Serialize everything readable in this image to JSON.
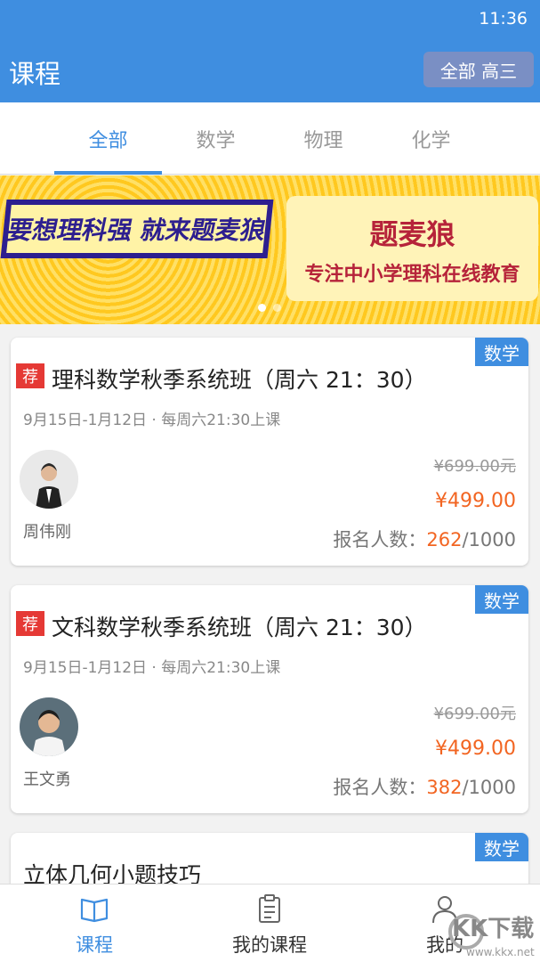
{
  "status": {
    "time": "11:36"
  },
  "header": {
    "title": "课程",
    "filter": "全部 高三"
  },
  "tabs": [
    {
      "label": "全部",
      "active": true
    },
    {
      "label": "数学",
      "active": false
    },
    {
      "label": "物理",
      "active": false
    },
    {
      "label": "化学",
      "active": false
    }
  ],
  "banner": {
    "slogan": "要想理科强 就来题麦狼",
    "brand": "题麦狼",
    "tagline": "专注中小学理科在线教育",
    "dots": 2,
    "active_dot": 0
  },
  "courses": [
    {
      "subject": "数学",
      "recommended": "荐",
      "title": "理科数学秋季系统班（周六 21：30）",
      "schedule": "9月15日-1月12日 · 每周六21:30上课",
      "teacher": "周伟刚",
      "original_price": "¥699.00元",
      "price": "¥499.00",
      "enroll_label": "报名人数：",
      "enrolled": "262",
      "capacity": "/1000"
    },
    {
      "subject": "数学",
      "recommended": "荐",
      "title": "文科数学秋季系统班（周六 21：30）",
      "schedule": "9月15日-1月12日 · 每周六21:30上课",
      "teacher": "王文勇",
      "original_price": "¥699.00元",
      "price": "¥499.00",
      "enroll_label": "报名人数：",
      "enrolled": "382",
      "capacity": "/1000"
    },
    {
      "subject": "数学",
      "title": "立体几何小题技巧"
    }
  ],
  "nav": [
    {
      "label": "课程",
      "icon": "book-icon",
      "active": true
    },
    {
      "label": "我的课程",
      "icon": "clipboard-icon",
      "active": false
    },
    {
      "label": "我的",
      "icon": "user-icon",
      "active": false
    }
  ],
  "watermark": {
    "text": "KK下载",
    "url": "www.kkx.net"
  },
  "colors": {
    "primary": "#3f8ee0",
    "price": "#f26522",
    "recommend": "#e53935"
  }
}
